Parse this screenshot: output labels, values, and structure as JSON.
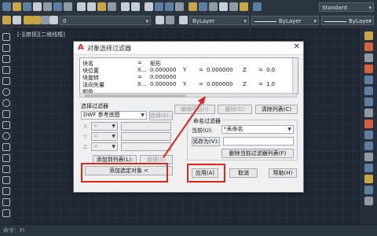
{
  "toolbar": {
    "layer_combo": "0",
    "color_combo": "ByLayer",
    "linetype_combo": "ByLayer",
    "lineweight_combo": "ByLayer",
    "style_combo": "Standard"
  },
  "viewport": {
    "label": "[-][俯视][二维线框]"
  },
  "status": {
    "command_text": "命令：FI"
  },
  "dialog": {
    "title": "对象选择过滤器",
    "list_rows": [
      {
        "name": "块名",
        "col1": "=",
        "val1": "矩形",
        "xlbl": "",
        "val2": "",
        "ylbl": "",
        "val3": "",
        "zlbl": "",
        "val4": ""
      },
      {
        "name": "块位置",
        "col1": "X...",
        "val1": "0.000000",
        "xlbl": "Y",
        "val2": "=",
        "ylbl": "0.000000",
        "val3": "Z",
        "zlbl": "=",
        "val4": "0.0"
      },
      {
        "name": "块旋转",
        "col1": "=",
        "val1": "0.000000",
        "xlbl": "",
        "val2": "",
        "ylbl": "",
        "val3": "",
        "zlbl": "",
        "val4": ""
      },
      {
        "name": "法向矢量",
        "col1": "X...",
        "val1": "0.000000",
        "xlbl": "Y",
        "val2": "=",
        "ylbl": "0.000000",
        "val3": "Z",
        "zlbl": "=",
        "val4": "1.0"
      },
      {
        "name": "颜色",
        "col1": "",
        "val1": "",
        "xlbl": "",
        "val2": "",
        "ylbl": "",
        "val3": "",
        "zlbl": "",
        "val4": ""
      }
    ],
    "edit_item_button": "编辑项目(I)",
    "delete_button": "删除(D)",
    "clear_list_button": "清除列表(C)",
    "select_filter_label": "选择过滤器",
    "filter_type_value": "DWF 参考底图",
    "select_button": "选择(E)...",
    "x_label": "X:",
    "y_label": "Y:",
    "z_label": "Z:",
    "x_op": "=",
    "y_op": "=",
    "z_op": "=",
    "add_to_list_button": "添加到列表(L):",
    "replace_button": "替换(S)",
    "add_selected_button": "添加选定对象 <",
    "named_filters_label": "命名过滤器",
    "current_label": "当前(U):",
    "current_value": "*未命名",
    "save_as_button": "另存为(V):",
    "save_as_value": "",
    "delete_current_button": "删除当前过滤器列表(F)",
    "apply_button": "应用(A)",
    "cancel_button": "取消",
    "help_button": "帮助(H)"
  },
  "colors": {
    "highlight": "#e0251b",
    "background": "#1f2733"
  }
}
